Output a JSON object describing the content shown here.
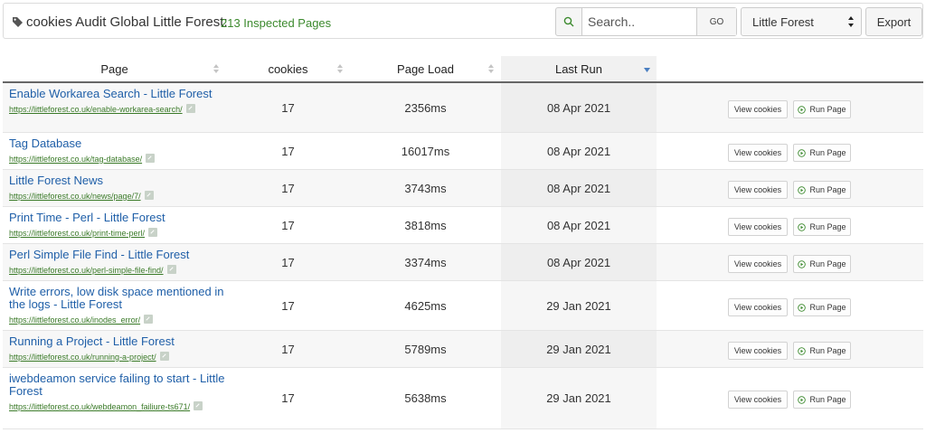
{
  "header": {
    "title": "cookies Audit Global Little Forest:",
    "inspected": "213 Inspected Pages",
    "search_placeholder": "Search..",
    "go_label": "GO",
    "site_selected": "Little Forest",
    "export_label": "Export"
  },
  "columns": {
    "page": "Page",
    "cookies": "cookies",
    "page_load": "Page Load",
    "last_run": "Last Run"
  },
  "rows": [
    {
      "title": "Enable Workarea Search - Little Forest",
      "url": "https://littleforest.co.uk/enable-workarea-search/",
      "cookies": "17",
      "load": "2356ms",
      "last_run": "08 Apr 2021",
      "view": "View cookies",
      "run": "Run Page"
    },
    {
      "title": "Tag Database",
      "url": "https://littleforest.co.uk/tag-database/",
      "cookies": "17",
      "load": "16017ms",
      "last_run": "08 Apr 2021",
      "view": "View cookies",
      "run": "Run Page"
    },
    {
      "title": "Little Forest News",
      "url": "https://littleforest.co.uk/news/page/7/",
      "cookies": "17",
      "load": "3743ms",
      "last_run": "08 Apr 2021",
      "view": "View cookies",
      "run": "Run Page"
    },
    {
      "title": "Print Time - Perl - Little Forest",
      "url": "https://littleforest.co.uk/print-time-perl/",
      "cookies": "17",
      "load": "3818ms",
      "last_run": "08 Apr 2021",
      "view": "View cookies",
      "run": "Run Page"
    },
    {
      "title": "Perl Simple File Find - Little Forest",
      "url": "https://littleforest.co.uk/perl-simple-file-find/",
      "cookies": "17",
      "load": "3374ms",
      "last_run": "08 Apr 2021",
      "view": "View cookies",
      "run": "Run Page"
    },
    {
      "title": "Write errors, low disk space mentioned in the logs - Little Forest",
      "url": "https://littleforest.co.uk/inodes_error/",
      "cookies": "17",
      "load": "4625ms",
      "last_run": "29 Jan 2021",
      "view": "View cookies",
      "run": "Run Page"
    },
    {
      "title": "Running a Project - Little Forest",
      "url": "https://littleforest.co.uk/running-a-project/",
      "cookies": "17",
      "load": "5789ms",
      "last_run": "29 Jan 2021",
      "view": "View cookies",
      "run": "Run Page"
    },
    {
      "title": "iwebdeamon service failing to start - Little Forest",
      "url": "https://littleforest.co.uk/webdeamon_failiure-ts671/",
      "cookies": "17",
      "load": "5638ms",
      "last_run": "29 Jan 2021",
      "view": "View cookies",
      "run": "Run Page"
    }
  ]
}
